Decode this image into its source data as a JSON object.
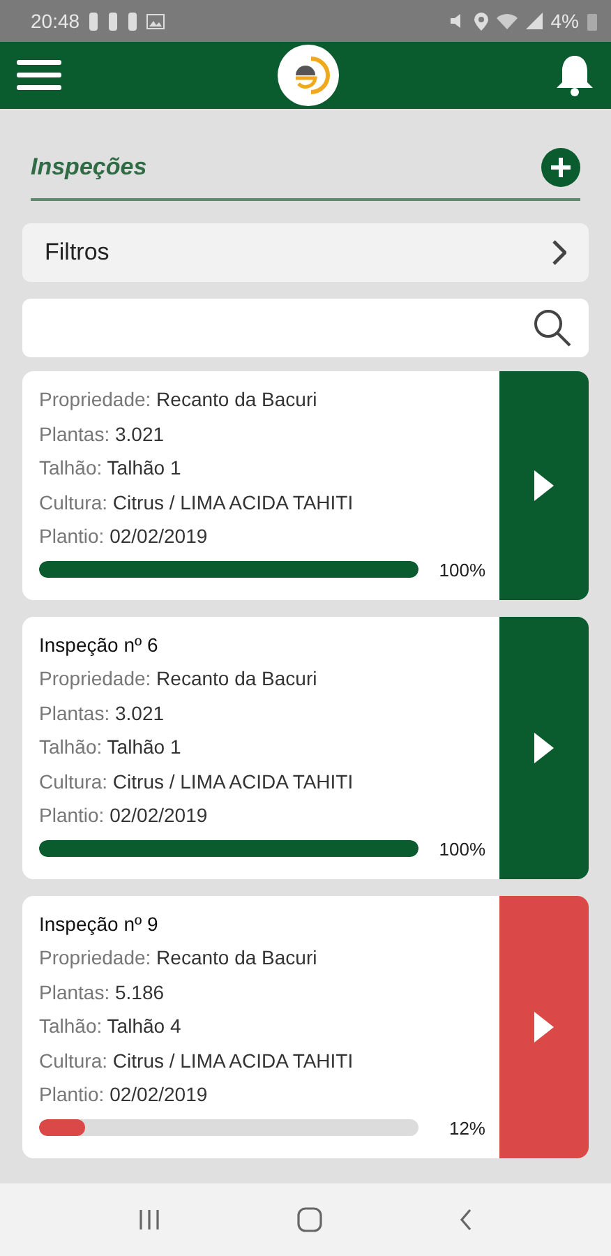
{
  "status_bar": {
    "time": "20:48",
    "battery": "4%"
  },
  "section": {
    "title": "Inspeções"
  },
  "filters": {
    "label": "Filtros"
  },
  "inspections": [
    {
      "fields": [
        {
          "label": "Propriedade:",
          "value": "Recanto da Bacuri"
        },
        {
          "label": "Plantas:",
          "value": "3.021"
        },
        {
          "label": "Talhão:",
          "value": "Talhão 1"
        },
        {
          "label": "Cultura:",
          "value": "Citrus / LIMA ACIDA TAHITI"
        },
        {
          "label": "Plantio:",
          "value": "02/02/2019"
        }
      ],
      "level": 1,
      "percent": "100%",
      "color": "#0a5c2e"
    },
    {
      "title": "Inspeção nº 6",
      "fields": [
        {
          "label": "Propriedade:",
          "value": "Recanto da Bacuri"
        },
        {
          "label": "Plantas:",
          "value": "3.021"
        },
        {
          "label": "Talhão:",
          "value": "Talhão 1"
        },
        {
          "label": "Cultura:",
          "value": "Citrus / LIMA ACIDA TAHITI"
        },
        {
          "label": "Plantio:",
          "value": "02/02/2019"
        }
      ],
      "level": 1,
      "percent": "100%",
      "color": "#0a5c2e"
    },
    {
      "title": "Inspeção nº 9",
      "fields": [
        {
          "label": "Propriedade:",
          "value": "Recanto da Bacuri"
        },
        {
          "label": "Plantas:",
          "value": "5.186"
        },
        {
          "label": "Talhão:",
          "value": "Talhão 4"
        },
        {
          "label": "Cultura:",
          "value": "Citrus / LIMA ACIDA TAHITI"
        },
        {
          "label": "Plantio:",
          "value": "02/02/2019"
        }
      ],
      "level": 0.12,
      "percent": "12%",
      "color": "#db4848"
    }
  ]
}
